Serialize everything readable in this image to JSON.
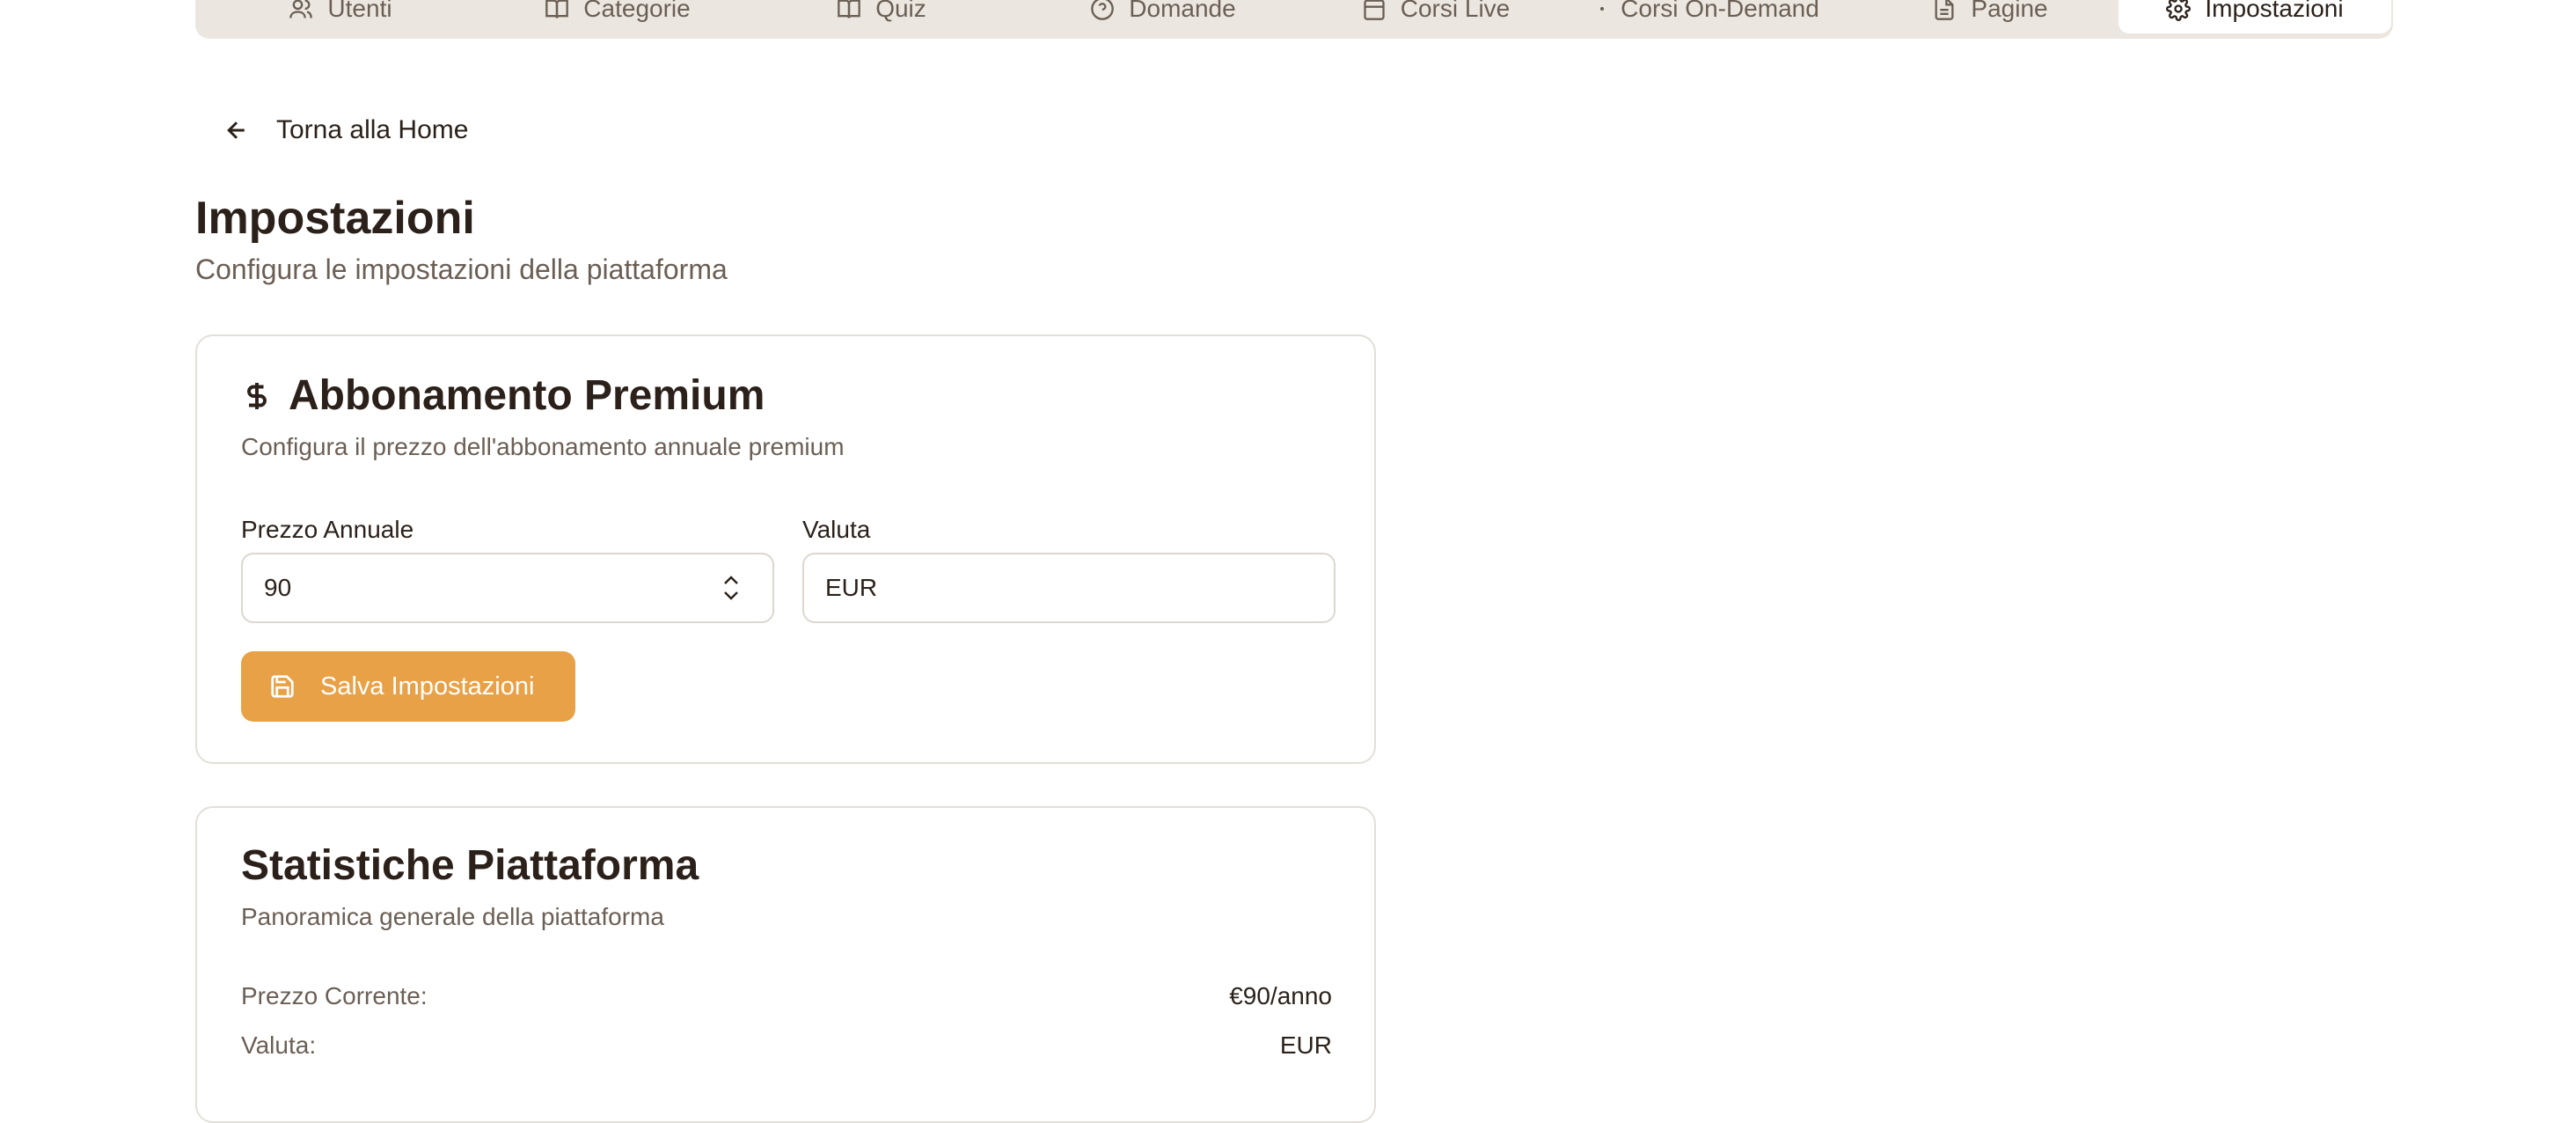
{
  "nav": {
    "tabs": [
      {
        "label": "Utenti",
        "icon": "users-icon"
      },
      {
        "label": "Categorie",
        "icon": "book-open-icon"
      },
      {
        "label": "Quiz",
        "icon": "book-open-icon"
      },
      {
        "label": "Domande",
        "icon": "help-circle-icon"
      },
      {
        "label": "Corsi Live",
        "icon": "calendar-icon"
      },
      {
        "label": "Corsi On-Demand",
        "icon": "dot-icon"
      },
      {
        "label": "Pagine",
        "icon": "file-text-icon"
      },
      {
        "label": "Impostazioni",
        "icon": "gear-icon",
        "active": true
      }
    ]
  },
  "back": {
    "label": "Torna alla Home",
    "icon": "arrow-left-icon"
  },
  "page": {
    "title": "Impostazioni",
    "subtitle": "Configura le impostazioni della piattaforma"
  },
  "premium": {
    "icon": "dollar-icon",
    "title": "Abbonamento Premium",
    "subtitle": "Configura il prezzo dell'abbonamento annuale premium",
    "price_label": "Prezzo Annuale",
    "price_value": "90",
    "currency_label": "Valuta",
    "currency_value": "EUR",
    "save_label": "Salva Impostazioni",
    "save_icon": "save-icon"
  },
  "stats": {
    "title": "Statistiche Piattaforma",
    "subtitle": "Panoramica generale della piattaforma",
    "rows": [
      {
        "label": "Prezzo Corrente:",
        "value": "€90/anno"
      },
      {
        "label": "Valuta:",
        "value": "EUR"
      }
    ]
  },
  "colors": {
    "accent": "#e8a146",
    "text": "#2b211a",
    "muted": "#6b5f55",
    "tabbar_bg": "#ebe7e0"
  }
}
